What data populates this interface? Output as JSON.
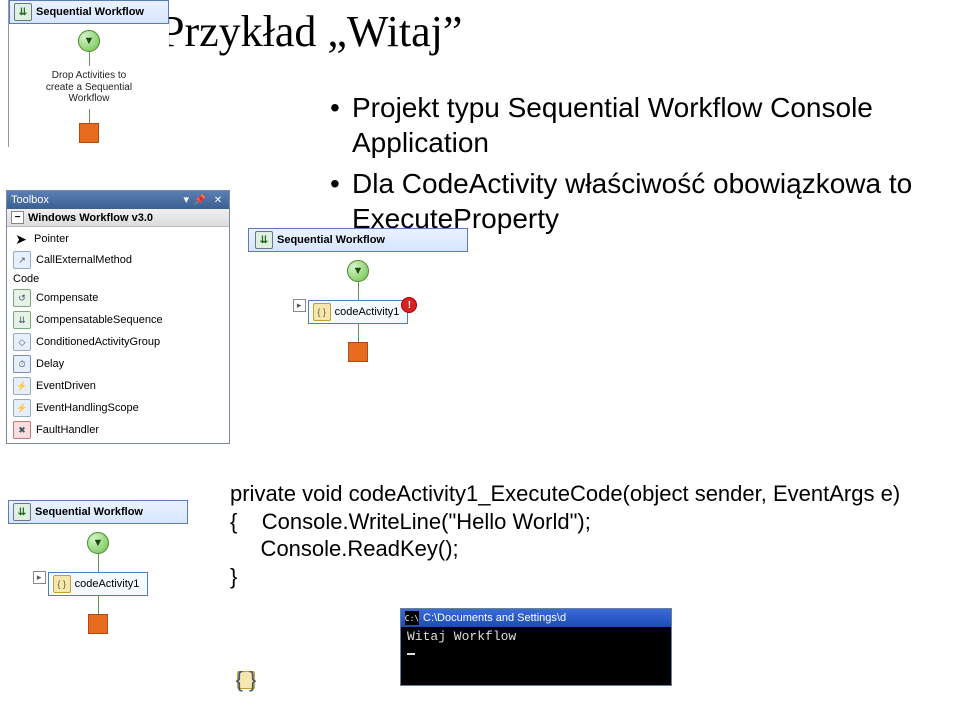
{
  "slide": {
    "title": "Przykład „Witaj”",
    "bullets": [
      "Projekt typu  Sequential Workflow Console Application",
      "Dla CodeActivity właściwość obowiązkowa to ExecuteProperty"
    ]
  },
  "topDesigner": {
    "title": "Sequential Workflow",
    "dropHint": "Drop Activities to\ncreate a Sequential\nWorkflow"
  },
  "toolbox": {
    "header": "Toolbox",
    "category": "Windows Workflow v3.0",
    "items": [
      "Pointer",
      "CallExternalMethod",
      "Code",
      "Compensate",
      "CompensatableSequence",
      "ConditionedActivityGroup",
      "Delay",
      "EventDriven",
      "EventHandlingScope",
      "FaultHandler"
    ]
  },
  "centerDesigner": {
    "title": "Sequential Workflow",
    "activityName": "codeActivity1"
  },
  "bottomDesigner": {
    "title": "Sequential Workflow",
    "activityName": "codeActivity1"
  },
  "codeSnippet": {
    "line1": "private void codeActivity1_ExecuteCode(object sender, EventArgs e)",
    "line2": "{    Console.WriteLine(\"Hello World\");",
    "line3": "     Console.ReadKey();",
    "line4": "}"
  },
  "consoleWindow": {
    "title": "C:\\Documents and Settings\\d",
    "output": "Witaj Workflow"
  }
}
